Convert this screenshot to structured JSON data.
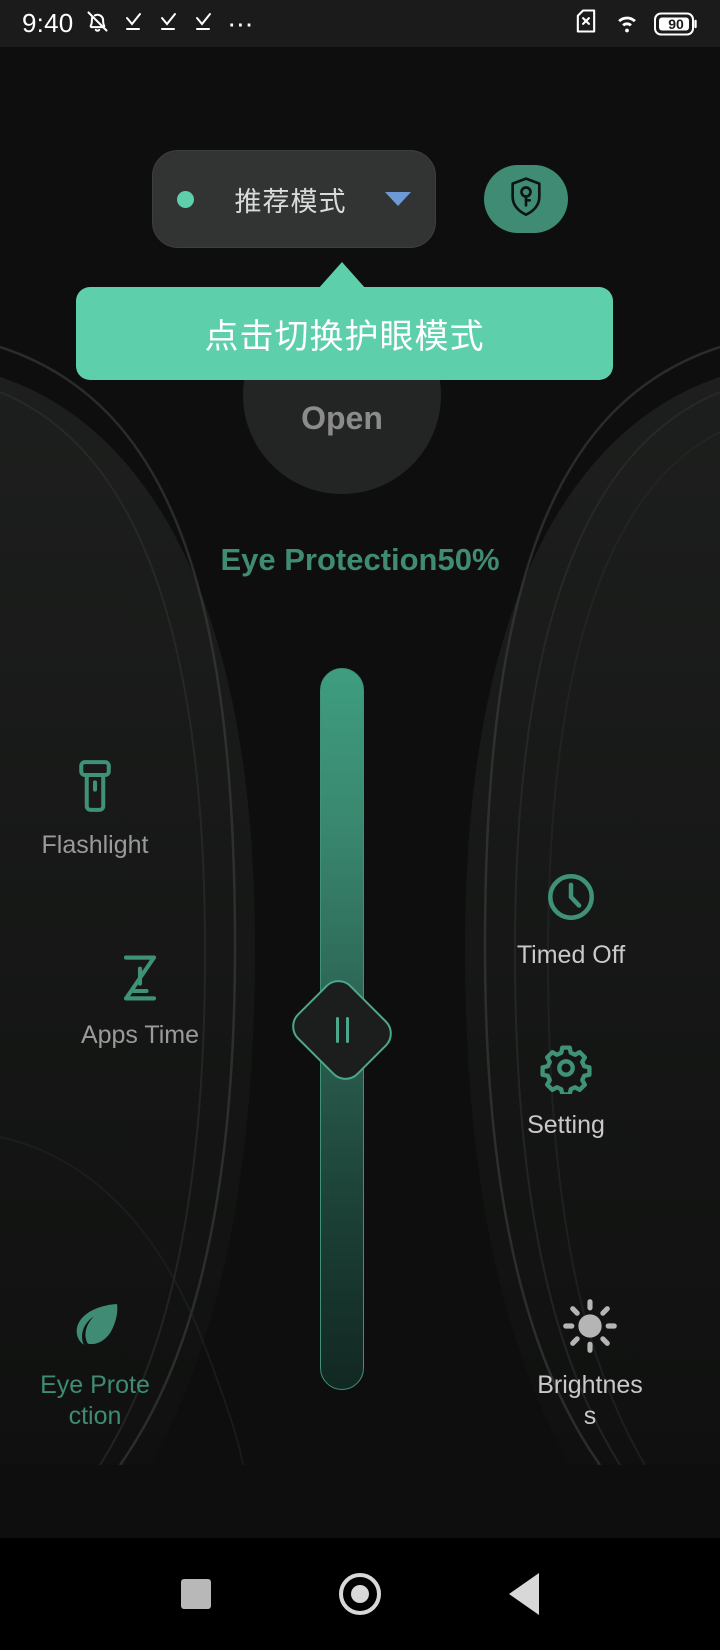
{
  "statusbar": {
    "time": "9:40",
    "dots": "⋯",
    "battery_level": "90",
    "icons": [
      "bell-mute-icon",
      "check-task-icon",
      "check-task-icon",
      "check-task-icon",
      "overflow-dots-icon",
      "sim-missing-icon",
      "wifi-icon",
      "battery-icon"
    ]
  },
  "mode_selector": {
    "label": "推荐模式",
    "dot_color": "#5ecfab",
    "caret_color": "#6c9ad6"
  },
  "shield_button": {
    "icon": "shield-key-icon",
    "bg_color": "#3f8b73"
  },
  "tooltip": {
    "text": "点击切换护眼模式",
    "bg_color": "#5ecfab"
  },
  "power": {
    "label": "Open"
  },
  "protection": {
    "text": "Eye Protection50%",
    "value": 50,
    "color": "#3f8b73"
  },
  "slider": {
    "value": 50,
    "handle_icon": "pause-grip-icon",
    "track_color": "#3f9177"
  },
  "quick_actions": [
    {
      "id": "flashlight",
      "label": "Flashlight",
      "icon": "flashlight-icon",
      "state": "inactive"
    },
    {
      "id": "apps-time",
      "label": "Apps Time",
      "icon": "hourglass-icon",
      "state": "inactive"
    },
    {
      "id": "eye-protection",
      "label": "Eye Prote\nction",
      "label_line1": "Eye Prote",
      "label_line2": "ction",
      "icon": "leaf-icon",
      "state": "active"
    },
    {
      "id": "timed-off",
      "label": "Timed Off",
      "icon": "clock-icon",
      "state": "inactive"
    },
    {
      "id": "setting",
      "label": "Setting",
      "icon": "gear-icon",
      "state": "inactive"
    },
    {
      "id": "brightness",
      "label_line1": "Brightnes",
      "label_line2": "s",
      "label": "Brightness",
      "icon": "sun-icon",
      "state": "inactive"
    }
  ],
  "navbar": {
    "recents": "recents-square-icon",
    "home": "home-circle-icon",
    "back": "back-triangle-icon"
  }
}
